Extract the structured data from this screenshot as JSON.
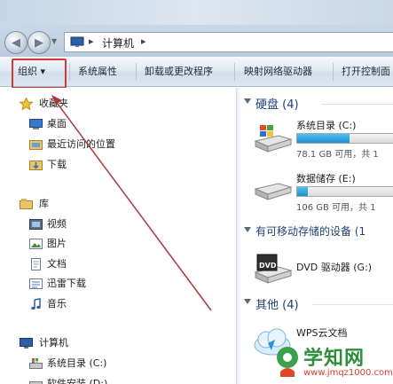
{
  "address": {
    "path": "计算机",
    "sep1": "▸",
    "sep2": "▸"
  },
  "toolbar": {
    "organize": "组织 ▾",
    "system_properties": "系统属性",
    "uninstall": "卸载或更改程序",
    "map_drive": "映射网络驱动器",
    "control_panel": "打开控制面"
  },
  "nav": {
    "favorites": "收藏夹",
    "desktop": "桌面",
    "recent": "最近访问的位置",
    "downloads": "下载",
    "libraries": "库",
    "videos": "视频",
    "pictures": "图片",
    "documents": "文档",
    "thunder": "迅雷下载",
    "music": "音乐",
    "computer": "计算机",
    "sysdrive": "系统目录 (C:)",
    "softdrive": "软件安装 (D:)"
  },
  "content": {
    "hdd_header": "硬盘 (4)",
    "removable_header": "有可移动存储的设备 (1",
    "other_header": "其他 (4)",
    "drives": [
      {
        "name": "系统目录 (C:)",
        "free": "78.1 GB 可用，共 1",
        "fill": 0.5
      },
      {
        "name": "数据储存 (E:)",
        "free": "106 GB 可用，共 1",
        "fill": 0.1
      }
    ],
    "dvd": "DVD 驱动器 (G:)",
    "dvd_label": "DVD",
    "wps": "WPS云文档"
  },
  "watermark": {
    "text": "学知网",
    "url": "www.jmqz1000.com"
  },
  "colors": {
    "highlight": "#d23a3a",
    "arrow": "#a83a3a",
    "header_text": "#1e3f73"
  }
}
